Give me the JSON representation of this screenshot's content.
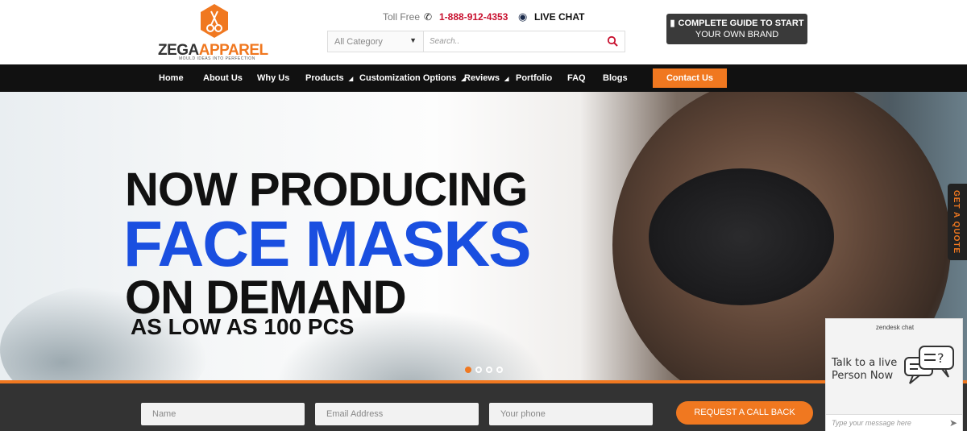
{
  "logo": {
    "brand_dark": "ZEGA",
    "brand_accent": "APPAREL",
    "tagline": "MOULD IDEAS INTO PERFECTION",
    "icon": "scissors-hexagon-icon"
  },
  "contact_bar": {
    "toll_free_label": "Toll Free",
    "phone": "1-888-912-4353",
    "live_chat": "LIVE CHAT"
  },
  "search": {
    "category": "All Category",
    "placeholder": "Search.."
  },
  "guide_button": {
    "line1": "COMPLETE GUIDE TO START",
    "line2": "YOUR OWN BRAND"
  },
  "nav": {
    "items": [
      {
        "label": "Home",
        "dropdown": false
      },
      {
        "label": "About Us",
        "dropdown": false
      },
      {
        "label": "Why Us",
        "dropdown": false
      },
      {
        "label": "Products",
        "dropdown": true
      },
      {
        "label": "Customization Options",
        "dropdown": true
      },
      {
        "label": "Reviews",
        "dropdown": true
      },
      {
        "label": "Portfolio",
        "dropdown": false
      },
      {
        "label": "FAQ",
        "dropdown": false
      },
      {
        "label": "Blogs",
        "dropdown": false
      }
    ],
    "contact_label": "Contact Us"
  },
  "hero": {
    "line1": "NOW PRODUCING",
    "line2": "FACE MASKS",
    "line3": "ON DEMAND",
    "line4": "AS LOW AS 100 PCS",
    "slides": 4,
    "active_slide": 1
  },
  "quote_tab": "GET A QUOTE",
  "form": {
    "name_placeholder": "Name",
    "email_placeholder": "Email Address",
    "phone_placeholder": "Your phone",
    "submit_label": "REQUEST A CALL BACK"
  },
  "chat_widget": {
    "brand": "zendesk chat",
    "prompt_line1": "Talk to a live",
    "prompt_line2": "Person Now",
    "input_placeholder": "Type your message here"
  },
  "colors": {
    "accent": "#f07820",
    "nav_bg": "#111111",
    "hero_blue": "#1a4fe0",
    "phone_red": "#c8102e"
  }
}
